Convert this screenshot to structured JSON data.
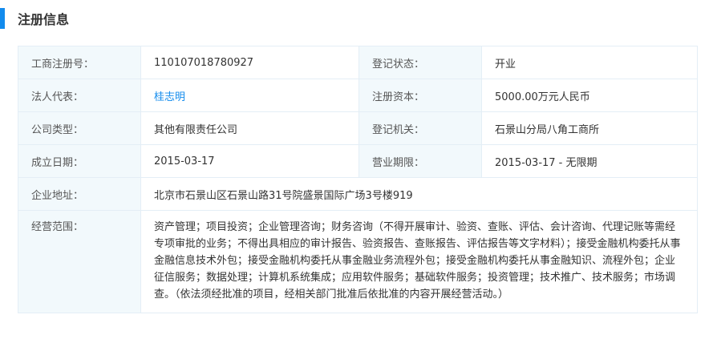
{
  "section_title": "注册信息",
  "accent": "#128bed",
  "rows": [
    {
      "label": "工商注册号：",
      "value": "110107018780927",
      "label2": "登记状态：",
      "value2": "开业"
    },
    {
      "label": "法人代表：",
      "value": "桂志明",
      "label2": "注册资本：",
      "value2": "5000.00万元人民币"
    },
    {
      "label": "公司类型：",
      "value": "其他有限责任公司",
      "label2": "登记机关：",
      "value2": "石景山分局八角工商所"
    },
    {
      "label": "成立日期：",
      "value": "2015-03-17",
      "label2": "营业期限：",
      "value2": "2015-03-17 - 无限期"
    }
  ],
  "address": {
    "label": "企业地址：",
    "value": "北京市石景山区石景山路31号院盛景国际广场3号楼919"
  },
  "scope": {
    "label": "经营范围：",
    "value": "资产管理；项目投资；企业管理咨询；财务咨询（不得开展审计、验资、查账、评估、会计咨询、代理记账等需经专项审批的业务；不得出具相应的审计报告、验资报告、查账报告、评估报告等文字材料）；接受金融机构委托从事金融信息技术外包；接受金融机构委托从事金融业务流程外包；接受金融机构委托从事金融知识、流程外包；企业征信服务；数据处理；计算机系统集成；应用软件服务；基础软件服务；投资管理；技术推广、技术服务；市场调查。（依法须经批准的项目，经相关部门批准后依批准的内容开展经营活动。）"
  }
}
